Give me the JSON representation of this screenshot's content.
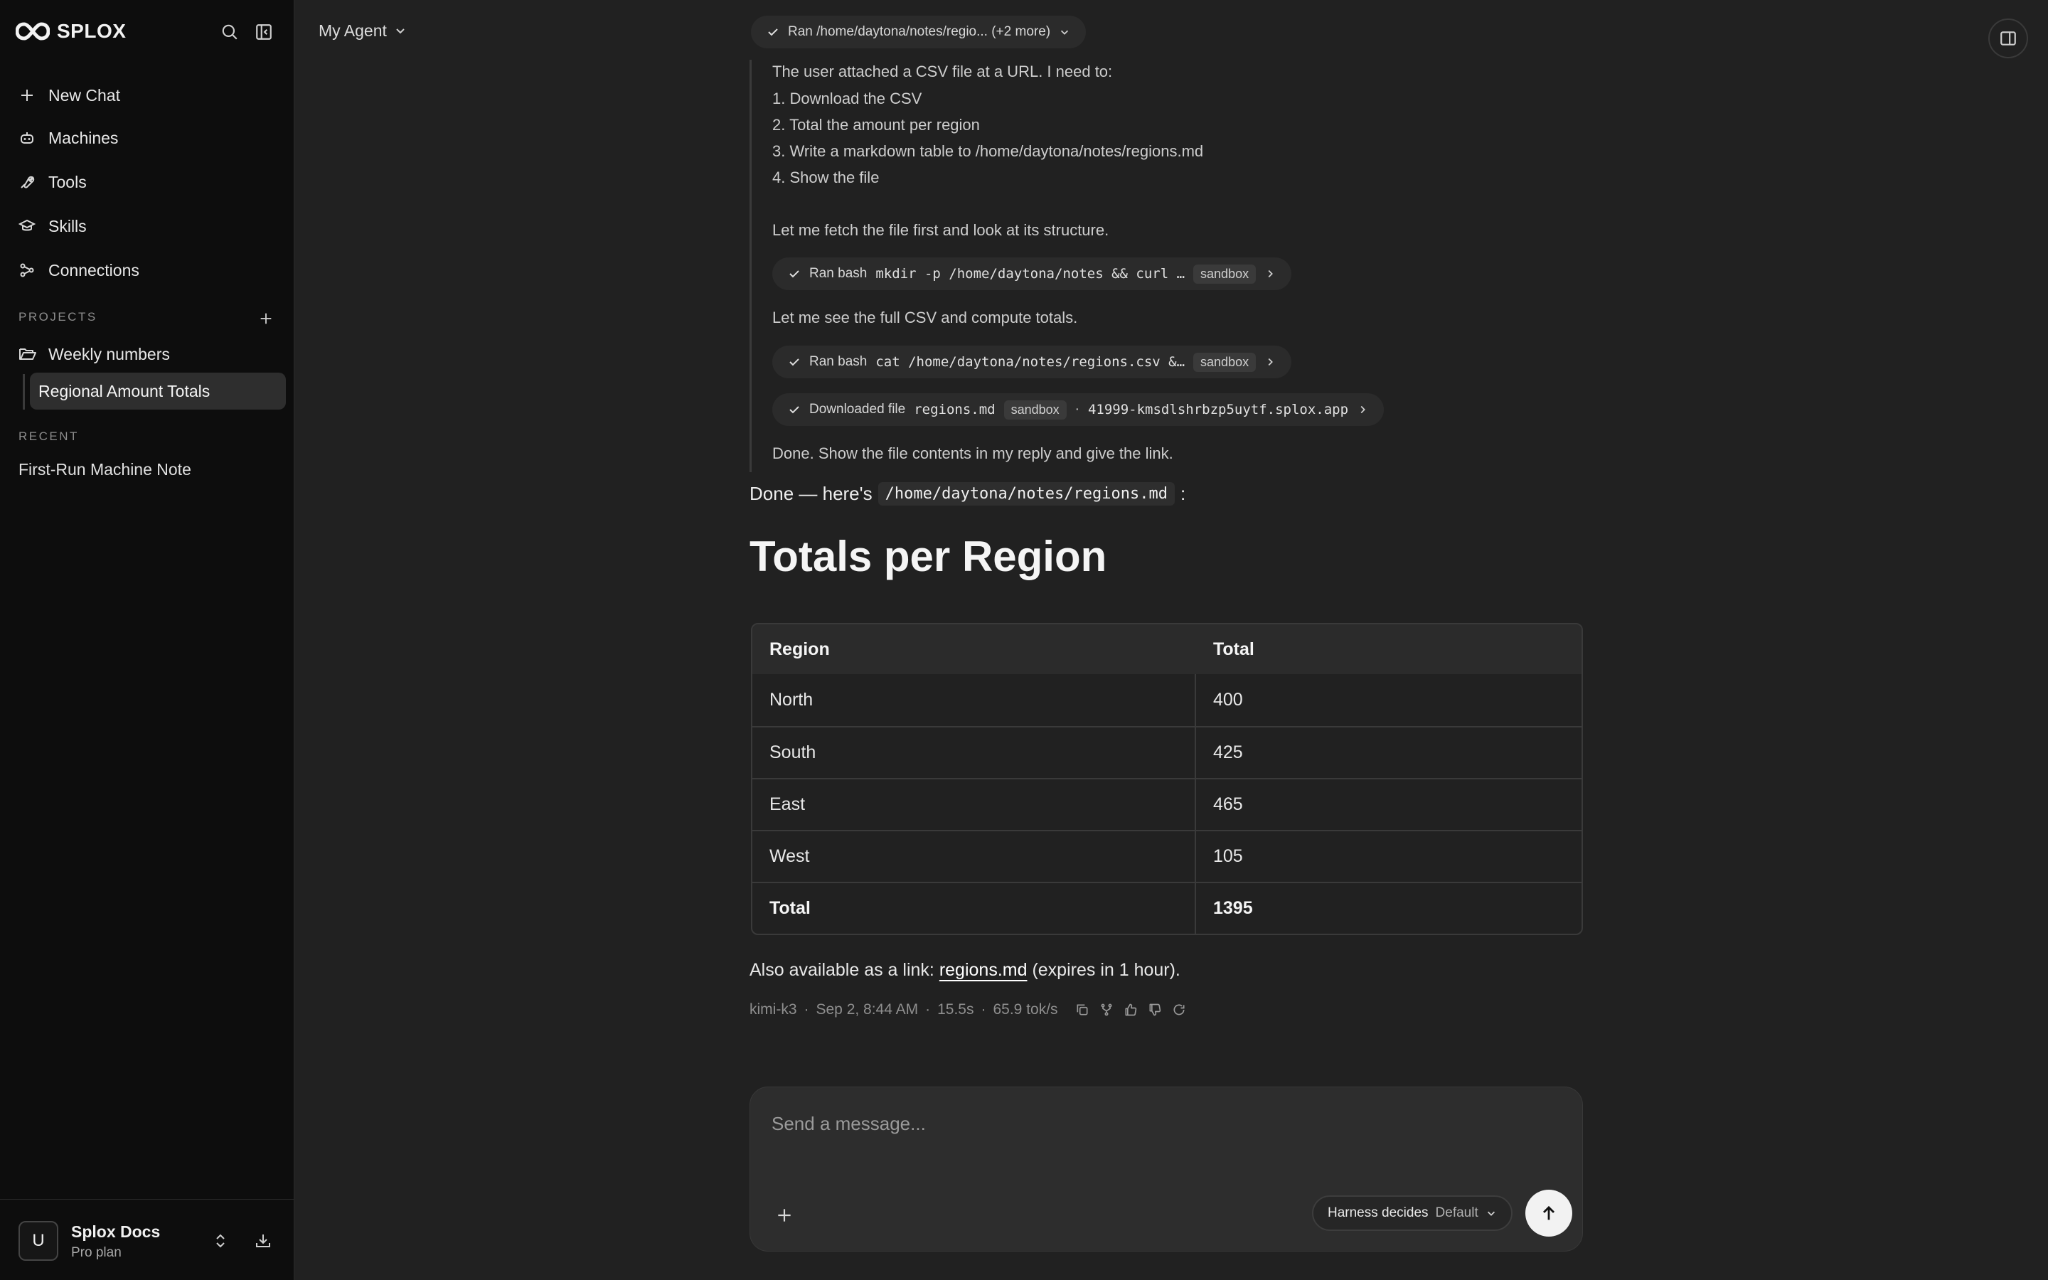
{
  "app": {
    "name": "SPLOX"
  },
  "sidebar": {
    "nav": [
      {
        "label": "New Chat",
        "icon": "plus-icon"
      },
      {
        "label": "Machines",
        "icon": "robot-icon"
      },
      {
        "label": "Tools",
        "icon": "wrench-icon"
      },
      {
        "label": "Skills",
        "icon": "graduation-cap-icon"
      },
      {
        "label": "Connections",
        "icon": "connections-icon"
      }
    ],
    "projects_label": "PROJECTS",
    "projects": [
      {
        "label": "Weekly numbers",
        "children": [
          {
            "label": "Regional Amount Totals",
            "active": true
          }
        ]
      }
    ],
    "recent_label": "RECENT",
    "recent": [
      {
        "label": "First-Run Machine Note"
      }
    ],
    "account": {
      "initial": "U",
      "name": "Splox Docs",
      "plan": "Pro plan"
    }
  },
  "topbar": {
    "agent": "My Agent"
  },
  "chat": {
    "tool_summary": "Ran /home/daytona/notes/regio... (+2 more)",
    "thinking": {
      "lines": [
        "The user attached a CSV file at a URL. I need to:",
        "1. Download the CSV",
        "2. Total the amount per region",
        "3. Write a markdown table to /home/daytona/notes/regions.md",
        "4. Show the file",
        "Let me fetch the file first and look at its structure.",
        "Let me see the full CSV and compute totals.",
        "Done. Show the file contents in my reply and give the link."
      ],
      "tool_calls": [
        {
          "prefix": "Ran bash",
          "code": "mkdir -p /home/daytona/notes && curl …",
          "tag": "sandbox"
        },
        {
          "prefix": "Ran bash",
          "code": "cat /home/daytona/notes/regions.csv &…",
          "tag": "sandbox"
        },
        {
          "prefix": "Downloaded file",
          "code": "regions.md",
          "tag": "sandbox",
          "sep": "·",
          "extra": "41999-kmsdlshrbzp5uytf.splox.app"
        }
      ]
    },
    "reply": {
      "intro": "Done — here's",
      "path": "/home/daytona/notes/regions.md",
      "colon": ":",
      "heading": "Totals per Region",
      "table": {
        "headers": [
          "Region",
          "Total"
        ],
        "rows": [
          [
            "North",
            "400"
          ],
          [
            "South",
            "425"
          ],
          [
            "East",
            "465"
          ],
          [
            "West",
            "105"
          ],
          [
            "Total",
            "1395"
          ]
        ]
      },
      "link_prefix": "Also available as a link:",
      "link_text": "regions.md",
      "link_suffix": "(expires in 1 hour)."
    },
    "meta": {
      "model": "kimi-k3",
      "time": "Sep 2, 8:44 AM",
      "duration": "15.5s",
      "speed": "65.9 tok/s",
      "sep": "·"
    }
  },
  "composer": {
    "placeholder": "Send a message...",
    "harness_label": "Harness decides",
    "harness_value": "Default"
  },
  "colors": {
    "background": "#212121",
    "sidebar": "#0d0d0d",
    "accent": "#f2f2f2"
  }
}
